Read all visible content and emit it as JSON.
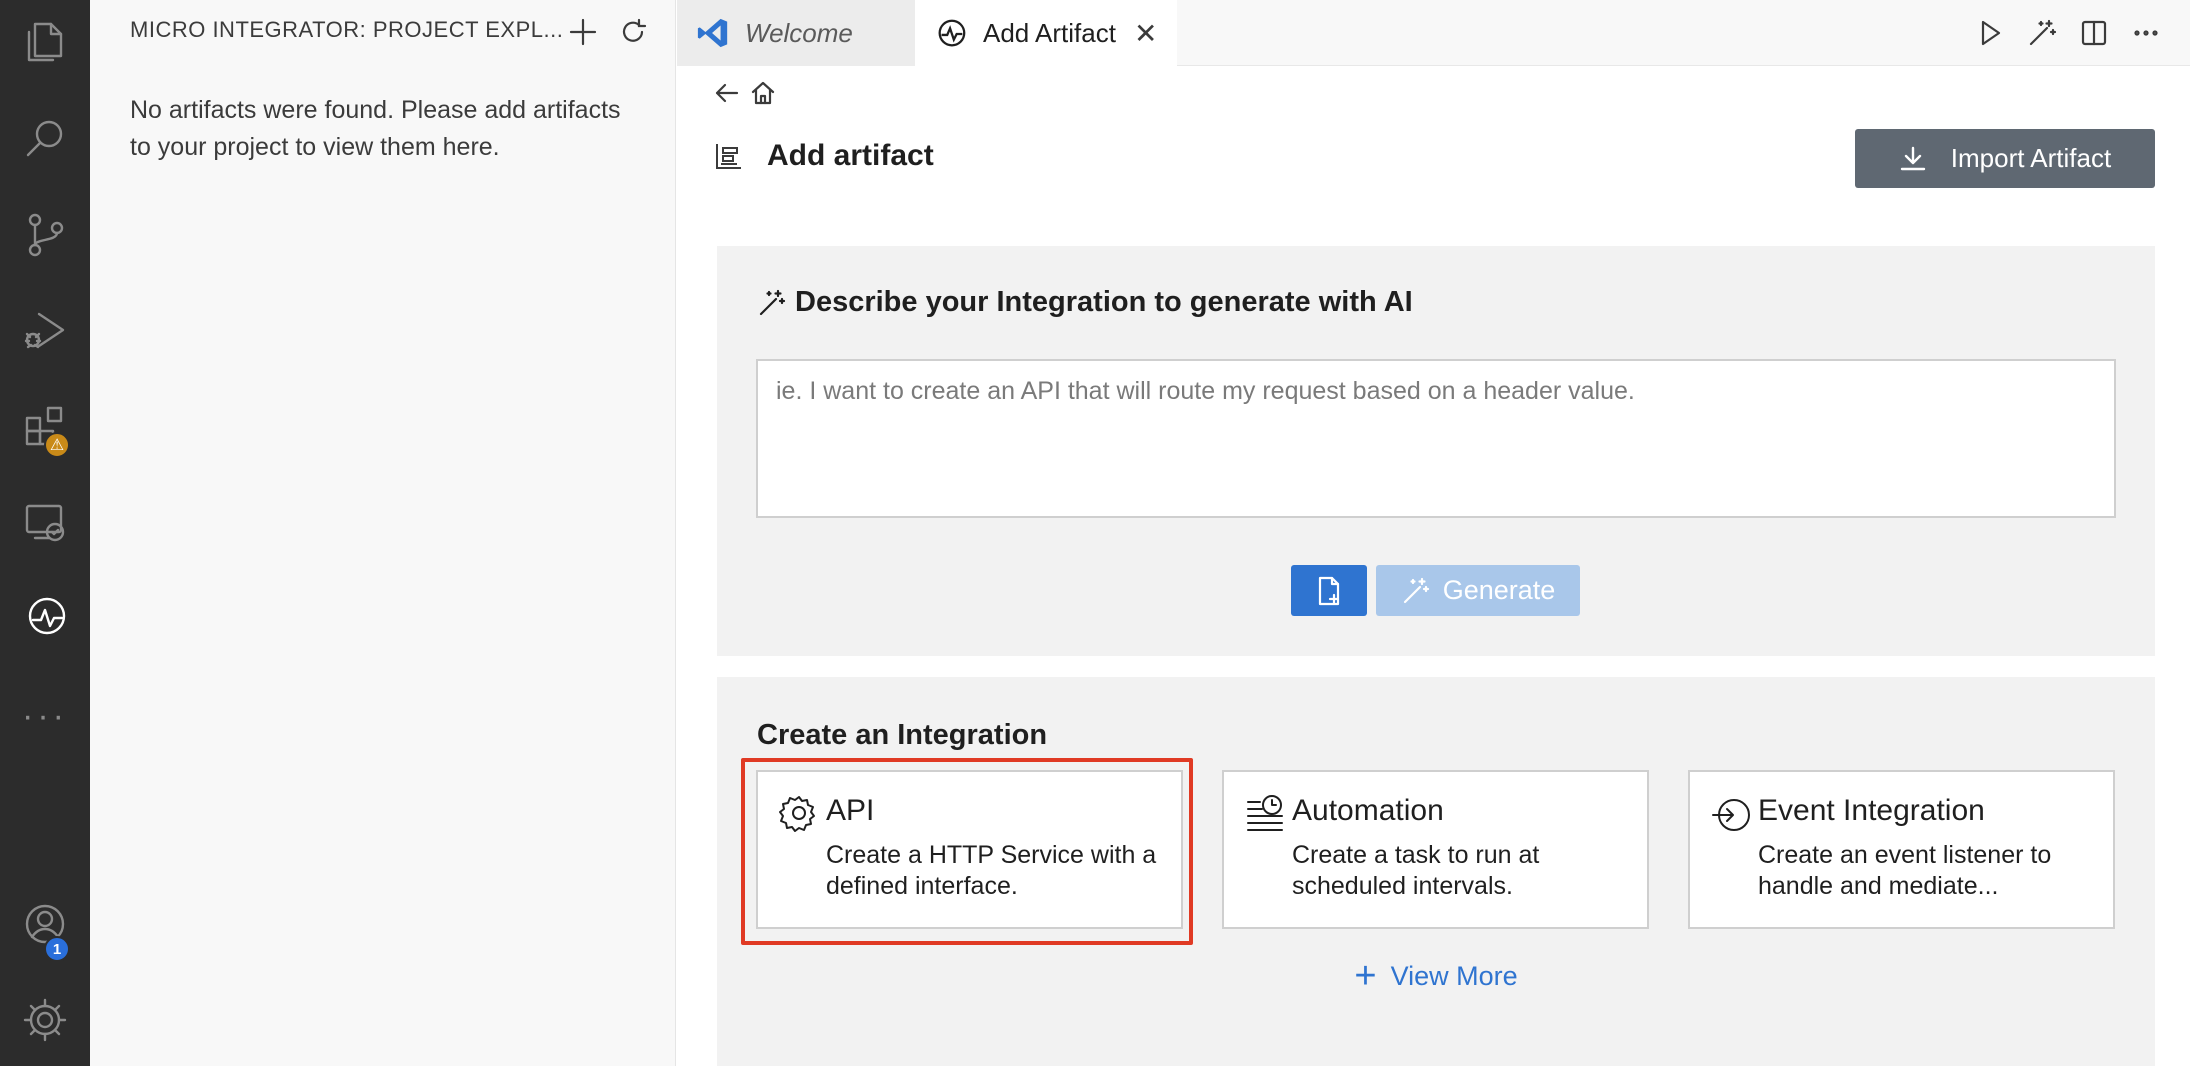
{
  "sidebar": {
    "title": "MICRO INTEGRATOR: PROJECT EXPL...",
    "empty_message": "No artifacts were found. Please add artifacts to your project to view them here."
  },
  "activity_bar": {
    "icons": [
      "files-icon",
      "search-icon",
      "source-control-icon",
      "run-debug-icon",
      "extensions-icon",
      "remote-explorer-icon",
      "micro-integrator-icon",
      "more-icon",
      "accounts-icon",
      "settings-icon"
    ],
    "accounts_badge": "1",
    "extensions_badge": "⚠"
  },
  "tabs": [
    {
      "label": "Welcome",
      "active": false
    },
    {
      "label": "Add Artifact",
      "active": true
    }
  ],
  "page": {
    "title": "Add artifact",
    "import_button": "Import Artifact"
  },
  "ai": {
    "heading": "Describe your Integration to generate with AI",
    "placeholder": "ie. I want to create an API that will route my request based on a header value.",
    "generate_label": "Generate"
  },
  "create": {
    "heading": "Create an Integration",
    "cards": [
      {
        "title": "API",
        "description": "Create a HTTP Service with a defined interface.",
        "icon": "gear-icon"
      },
      {
        "title": "Automation",
        "description": "Create a task to run at scheduled intervals.",
        "icon": "scheduled-task-icon"
      },
      {
        "title": "Event Integration",
        "description": "Create an event listener to handle and mediate...",
        "icon": "event-listener-icon"
      }
    ],
    "view_more": "View More"
  },
  "colors": {
    "accent": "#2f74d0",
    "highlight": "#e03a24",
    "activity_bar": "#2c2c2c"
  }
}
